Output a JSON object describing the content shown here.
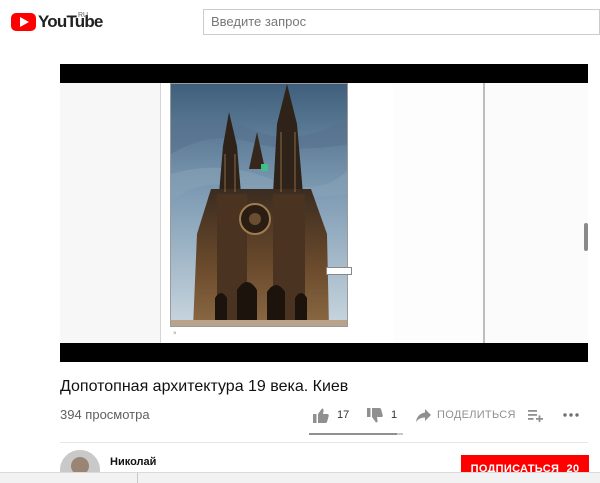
{
  "header": {
    "logo_text": "YouTube",
    "logo_region": "RU",
    "search_placeholder": "Введите запрос"
  },
  "player": {
    "scroll_position": 0.55
  },
  "video": {
    "title": "Допотопная архитектура 19 века. Киев",
    "views": "394 просмотра",
    "likes": "17",
    "dislikes": "1",
    "share_label": "ПОДЕЛИТЬСЯ",
    "like_ratio": 0.94
  },
  "channel": {
    "name": "Николай",
    "subscribe_label": "ПОДПИСАТЬСЯ",
    "subscriber_count": "20"
  },
  "colors": {
    "brand_red": "#ff0000",
    "text_primary": "#111111",
    "text_secondary": "#606060"
  },
  "icons": [
    "youtube-play-icon",
    "like-icon",
    "dislike-icon",
    "share-icon",
    "add-to-playlist-icon",
    "more-icon"
  ]
}
